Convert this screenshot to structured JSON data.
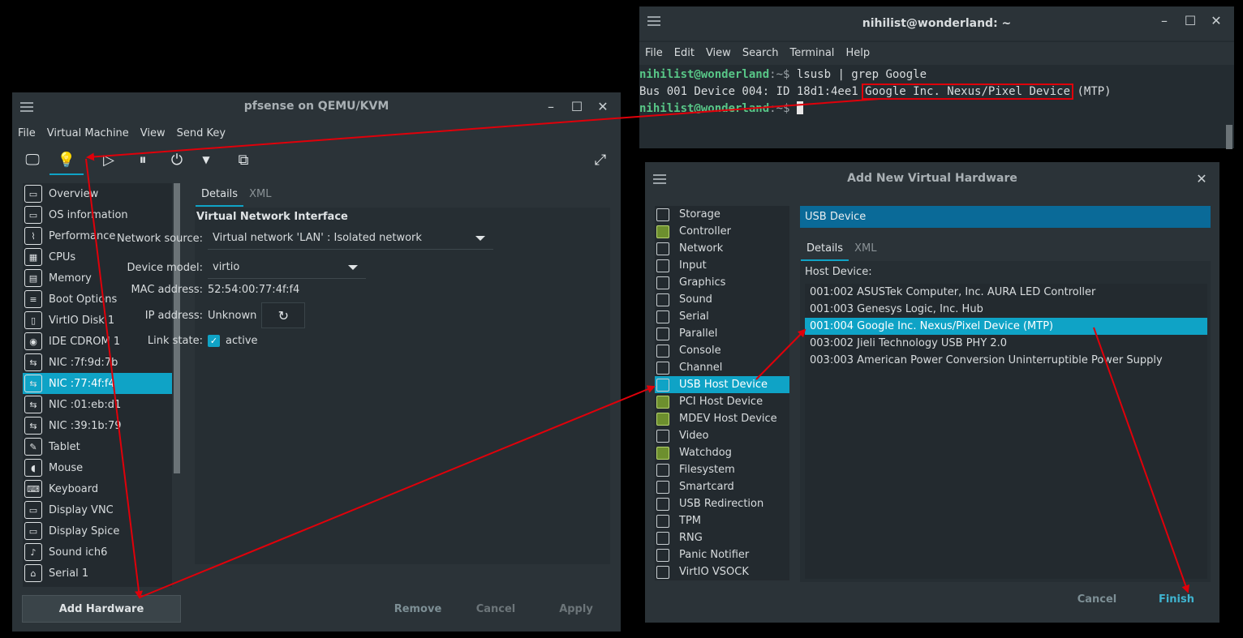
{
  "terminal": {
    "title": "nihilist@wonderland: ~",
    "menu": [
      "File",
      "Edit",
      "View",
      "Search",
      "Terminal",
      "Help"
    ],
    "line1_user": "nihilist@wonderland",
    "line1_sep": ":~$ ",
    "line1_cmd": "lsusb | grep Google",
    "line2_prefix": "Bus 001 Device 004: ID 18d1:4ee1 ",
    "line2_highlight": "Google Inc. Nexus/Pixel Device",
    "line2_suffix": " (MTP)",
    "line3_user": "nihilist@wonderland",
    "line3_sep": ":~$ "
  },
  "vm": {
    "title": "pfsense on QEMU/KVM",
    "menu": [
      "File",
      "Virtual Machine",
      "View",
      "Send Key"
    ],
    "sidebar": [
      {
        "label": "Overview",
        "icon": "monitor-icon"
      },
      {
        "label": "OS information",
        "icon": "monitor-icon"
      },
      {
        "label": "Performance",
        "icon": "chart-icon"
      },
      {
        "label": "CPUs",
        "icon": "cpu-icon"
      },
      {
        "label": "Memory",
        "icon": "memory-icon"
      },
      {
        "label": "Boot Options",
        "icon": "boot-icon"
      },
      {
        "label": "VirtIO Disk 1",
        "icon": "disk-icon"
      },
      {
        "label": "IDE CDROM 1",
        "icon": "cdrom-icon"
      },
      {
        "label": "NIC :7f:9d:7b",
        "icon": "nic-icon"
      },
      {
        "label": "NIC :77:4f:f4",
        "icon": "nic-icon"
      },
      {
        "label": "NIC :01:eb:d1",
        "icon": "nic-icon"
      },
      {
        "label": "NIC :39:1b:79",
        "icon": "nic-icon"
      },
      {
        "label": "Tablet",
        "icon": "tablet-icon"
      },
      {
        "label": "Mouse",
        "icon": "mouse-icon"
      },
      {
        "label": "Keyboard",
        "icon": "keyboard-icon"
      },
      {
        "label": "Display VNC",
        "icon": "display-icon"
      },
      {
        "label": "Display Spice",
        "icon": "display-icon"
      },
      {
        "label": "Sound ich6",
        "icon": "sound-icon"
      },
      {
        "label": "Serial 1",
        "icon": "serial-icon"
      }
    ],
    "selected_index": 9,
    "tabs": [
      "Details",
      "XML"
    ],
    "section_title": "Virtual Network Interface",
    "network_source_label": "Network source:",
    "network_source_value": "Virtual network 'LAN' : Isolated network",
    "device_model_label": "Device model:",
    "device_model_value": "virtio",
    "mac_label": "MAC address:",
    "mac_value": "52:54:00:77:4f:f4",
    "ip_label": "IP address:",
    "ip_value": "Unknown",
    "link_label": "Link state:",
    "link_value": "active",
    "add_hardware": "Add Hardware",
    "remove": "Remove",
    "cancel": "Cancel",
    "apply": "Apply"
  },
  "addhw": {
    "title": "Add New Virtual Hardware",
    "items": [
      {
        "label": "Storage",
        "icon": "storage-icon"
      },
      {
        "label": "Controller",
        "icon": "controller-icon"
      },
      {
        "label": "Network",
        "icon": "network-icon"
      },
      {
        "label": "Input",
        "icon": "input-icon"
      },
      {
        "label": "Graphics",
        "icon": "graphics-icon"
      },
      {
        "label": "Sound",
        "icon": "sound-icon"
      },
      {
        "label": "Serial",
        "icon": "serial-icon"
      },
      {
        "label": "Parallel",
        "icon": "parallel-icon"
      },
      {
        "label": "Console",
        "icon": "console-icon"
      },
      {
        "label": "Channel",
        "icon": "channel-icon"
      },
      {
        "label": "USB Host Device",
        "icon": "usb-icon"
      },
      {
        "label": "PCI Host Device",
        "icon": "pci-icon"
      },
      {
        "label": "MDEV Host Device",
        "icon": "mdev-icon"
      },
      {
        "label": "Video",
        "icon": "video-icon"
      },
      {
        "label": "Watchdog",
        "icon": "watchdog-icon"
      },
      {
        "label": "Filesystem",
        "icon": "folder-icon"
      },
      {
        "label": "Smartcard",
        "icon": "smartcard-icon"
      },
      {
        "label": "USB Redirection",
        "icon": "usb-icon"
      },
      {
        "label": "TPM",
        "icon": "tpm-icon"
      },
      {
        "label": "RNG",
        "icon": "rng-icon"
      },
      {
        "label": "Panic Notifier",
        "icon": "panic-icon"
      },
      {
        "label": "VirtIO VSOCK",
        "icon": "vsock-icon"
      }
    ],
    "selected_index": 10,
    "header": "USB Device",
    "tabs": [
      "Details",
      "XML"
    ],
    "host_device_label": "Host Device:",
    "devices": [
      "001:002 ASUSTek Computer, Inc. AURA LED Controller",
      "001:003 Genesys Logic, Inc. Hub",
      "001:004 Google Inc. Nexus/Pixel Device (MTP)",
      "003:002 Jieli Technology USB PHY 2.0",
      "003:003 American Power Conversion Uninterruptible Power Supply"
    ],
    "selected_device_index": 2,
    "cancel": "Cancel",
    "finish": "Finish"
  },
  "colors": {
    "accent": "#0fa3c6",
    "annotation": "#e0000a",
    "prompt": "#58c687"
  }
}
